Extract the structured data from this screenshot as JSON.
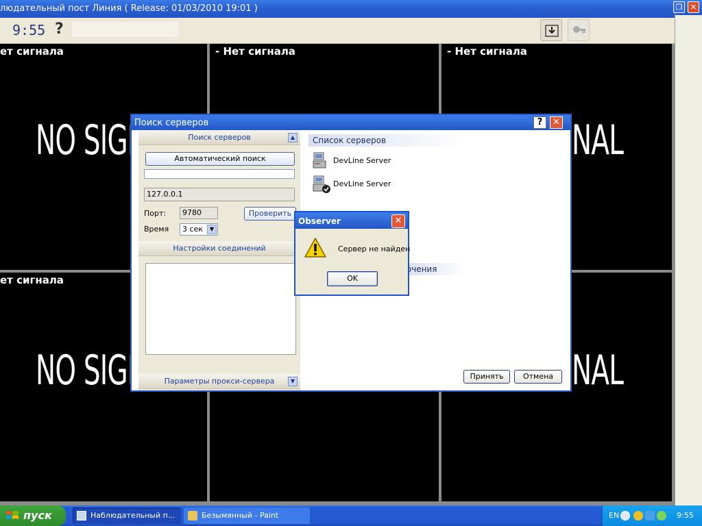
{
  "app": {
    "title": "людательный пост Линия ( Release: 01/03/2010  19:01 )",
    "titlebar_buttons": {
      "maximize": "❐",
      "close": "✕"
    }
  },
  "toolbar": {
    "clock": "9:55",
    "help": "?"
  },
  "cameras": [
    {
      "label": "ет сигнала",
      "overlay": "NO SIGNA"
    },
    {
      "label": "- Нет сигнала",
      "overlay": ""
    },
    {
      "label": "- Нет сигнала",
      "overlay": "NAL"
    },
    {
      "label": "ет сигнала",
      "overlay": "NO SIGNA"
    },
    {
      "label": "",
      "overlay": ""
    },
    {
      "label": "",
      "overlay": "NAL"
    }
  ],
  "search_dialog": {
    "title": "Поиск серверов",
    "help_button": "?",
    "close_button": "✕",
    "search_section": "Поиск серверов",
    "auto_search_button": "Автоматический поиск",
    "progress": 0.0,
    "address": "127.0.0.1",
    "port_label": "Порт:",
    "port_value": "9780",
    "check_button": "Проверить",
    "time_label": "Время",
    "time_value": "3 сек",
    "connection_settings_section": "Настройки соединений",
    "proxy_section": "Параметры прокси-сервера",
    "server_list_title": "Список серверов",
    "servers": [
      {
        "name": "DevLine Server",
        "checked": false
      },
      {
        "name": "DevLine Server",
        "checked": true
      }
    ],
    "connection_title": "ючения",
    "accept_button": "Принять",
    "cancel_button": "Отмена"
  },
  "msgbox": {
    "title": "Observer",
    "close_button": "✕",
    "message": "Сервер не найден",
    "ok_button": "OK"
  },
  "taskbar": {
    "start_label": "пуск",
    "tasks": [
      {
        "label": "Наблюдательный п..."
      },
      {
        "label": "Безымянный - Paint"
      }
    ],
    "lang": "EN",
    "clock": "9:55"
  },
  "colors": {
    "titlebar_blue": "#2456c6",
    "start_green": "#2e8b2b",
    "tray_blue": "#0b8ae0",
    "video_bg": "#000000"
  }
}
